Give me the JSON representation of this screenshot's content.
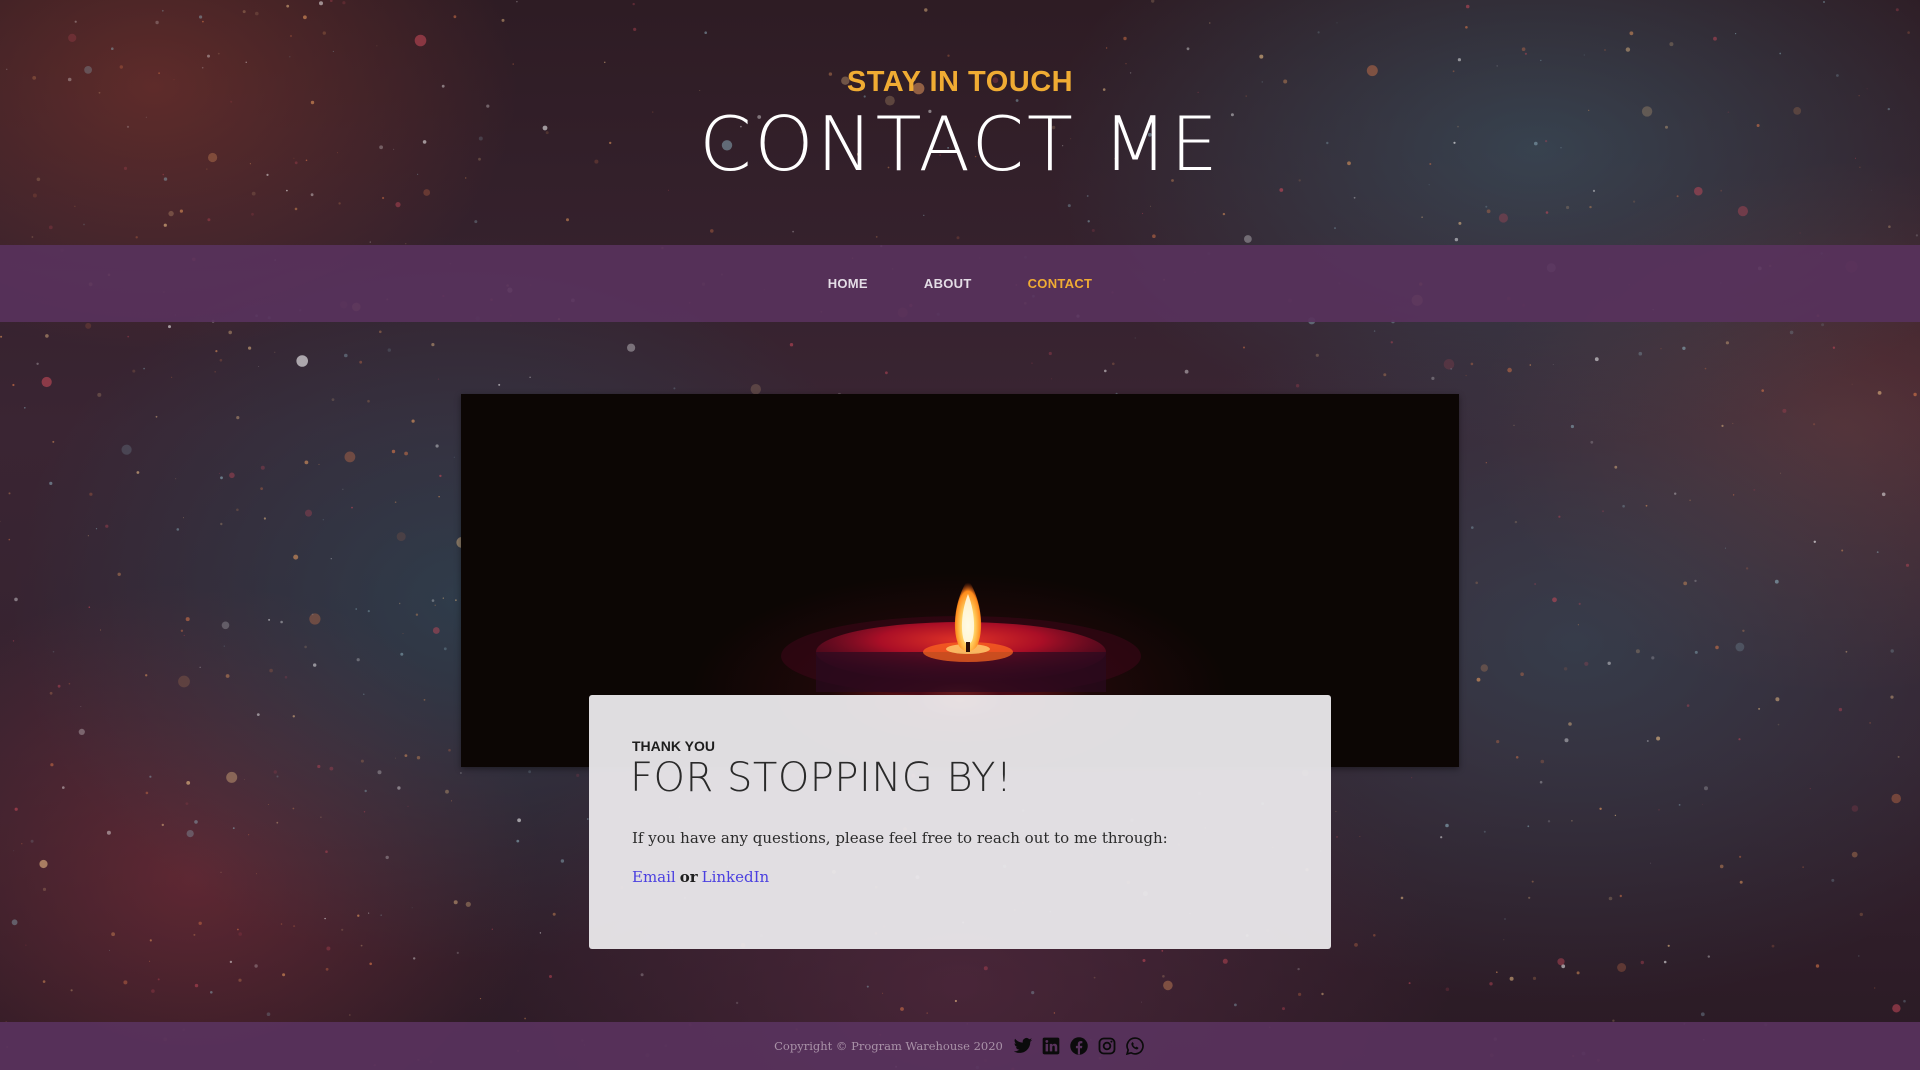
{
  "hero": {
    "kicker": "STAY IN TOUCH",
    "title": "CONTACT ME"
  },
  "nav": {
    "items": [
      {
        "label": "HOME",
        "active": false
      },
      {
        "label": "ABOUT",
        "active": false
      },
      {
        "label": "CONTACT",
        "active": true
      }
    ]
  },
  "card": {
    "kicker": "THANK YOU",
    "title": "FOR STOPPING BY!",
    "text": "If you have any questions, please feel free to reach out to me through:",
    "email_label": "Email",
    "or_label": "or",
    "linkedin_label": "LinkedIn"
  },
  "footer": {
    "copyright": "Copyright © Program Warehouse 2020",
    "social_icons": [
      "twitter-icon",
      "linkedin-icon",
      "facebook-icon",
      "instagram-icon",
      "whatsapp-icon"
    ]
  },
  "colors": {
    "accent": "#f0ac33",
    "nav_bg": "#58325c",
    "link": "#4a3fe0"
  }
}
